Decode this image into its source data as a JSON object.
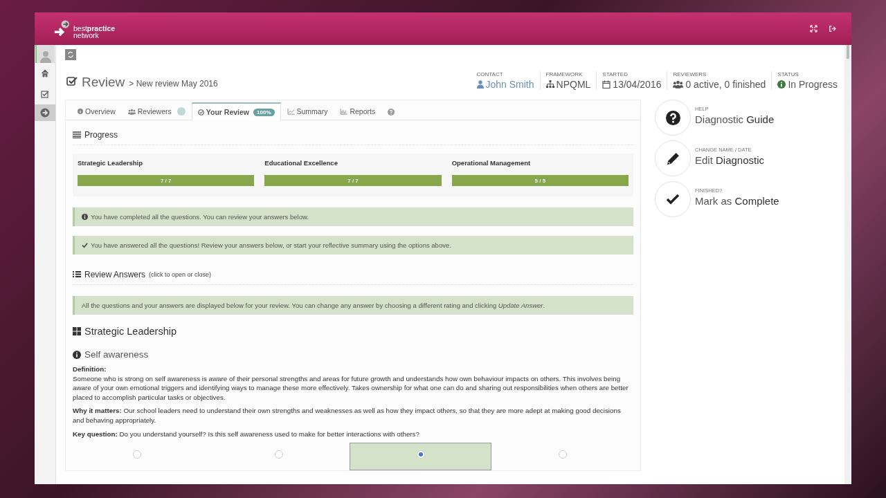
{
  "brand": {
    "line1_light": "best",
    "line1_bold": "practice",
    "line2": "network"
  },
  "title": {
    "main": "Review",
    "crumb": "> New review May 2016"
  },
  "meta": [
    {
      "kind": "contact",
      "label": "CONTACT",
      "value": "John Smith"
    },
    {
      "kind": "framework",
      "label": "FRAMEWORK",
      "value": "NPQML"
    },
    {
      "kind": "date",
      "label": "STARTED",
      "value": "13/04/2016"
    },
    {
      "kind": "reviewers",
      "label": "REVIEWERS",
      "value": "0 active, 0 finished"
    },
    {
      "kind": "status",
      "label": "STATUS",
      "value": "In Progress"
    }
  ],
  "tabs": [
    {
      "kind": "info",
      "label": "Overview",
      "selected": false
    },
    {
      "kind": "people",
      "label": "Reviewers",
      "selected": false,
      "badge_dot": true
    },
    {
      "kind": "check",
      "label": "Your Review",
      "selected": true,
      "badge": "100%"
    },
    {
      "kind": "line",
      "label": "Summary",
      "selected": false
    },
    {
      "kind": "bar",
      "label": "Reports",
      "selected": false
    },
    {
      "kind": "help",
      "selected": false
    }
  ],
  "progress": {
    "title": "Progress",
    "groups": [
      {
        "name": "Strategic Leadership",
        "reading": "7 / 7",
        "level": 1
      },
      {
        "name": "Educational Excellence",
        "reading": "7 / 7",
        "level": 1
      },
      {
        "name": "Operational Management",
        "reading": "5 / 5",
        "level": 1
      }
    ]
  },
  "alerts": [
    {
      "kind": "info",
      "text": "You have completed all the questions. You can review your answers below."
    },
    {
      "kind": "check",
      "text": "You have answered all the questions! Review your answers below, or start your reflective summary using the options above."
    }
  ],
  "review_answers": {
    "title": "Review Answers",
    "hint": "(click to open or close)",
    "note": "All the questions and your answers are displayed below for your review. You can change any answer by choosing a different rating and clicking *Update Answer*."
  },
  "section": {
    "title": "Strategic Leadership",
    "competency": "Self awareness",
    "definition_label": "Definition:",
    "definition": "Someone who is strong on self awareness is aware of their personal strengths and areas for future growth and understands how own behaviour impacts on others. This involves being aware of your own emotional triggers and identifying ways to manage these more effectively. Takes ownership for what one can do and sharing out responsibilities when others are better placed to accomplish particular tasks or objectives.",
    "why": "**Why it matters:** Our school leaders need to understand their own strengths and weaknesses as well as how they impact others, so that they are more adept at making good decisions and behaving appropriately.",
    "key": "**Key question:** Do you understand yourself? Is this self awareness used to make for better interactions with others?",
    "options": [
      {
        "selected": false
      },
      {
        "selected": false
      },
      {
        "selected": true
      },
      {
        "selected": false
      }
    ]
  },
  "actions": [
    {
      "kind": "help",
      "label": "HELP",
      "title": "Diagnostic **Guide**"
    },
    {
      "kind": "edit",
      "label": "CHANGE NAME / DATE",
      "title": "Edit **Diagnostic**"
    },
    {
      "kind": "done",
      "label": "FINISHED?",
      "title": "Mark as **Complete**"
    }
  ]
}
